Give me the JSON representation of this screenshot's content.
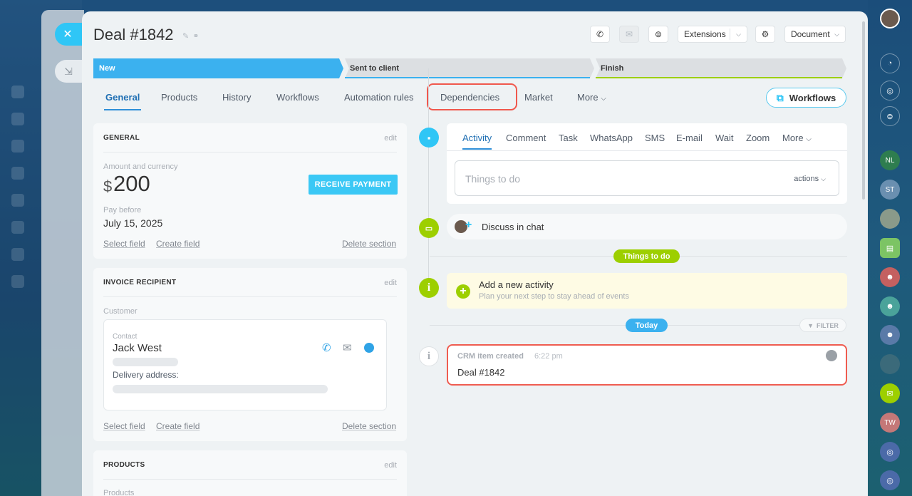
{
  "deal": {
    "title": "Deal #1842"
  },
  "toolbar": {
    "extensions_label": "Extensions",
    "document_label": "Document"
  },
  "stages": [
    {
      "label": "New",
      "color": "#3bb1ef"
    },
    {
      "label": "Sent to client",
      "color": "#dcdfe2"
    },
    {
      "label": "Finish",
      "color": "#dcdfe2"
    }
  ],
  "tabs": {
    "general": "General",
    "products": "Products",
    "history": "History",
    "workflows": "Workflows",
    "automation": "Automation rules",
    "dependencies": "Dependencies",
    "market": "Market",
    "more": "More"
  },
  "workflows_button": "Workflows",
  "general_section": {
    "header": "GENERAL",
    "edit": "edit",
    "amount_label": "Amount and currency",
    "currency_symbol": "$",
    "amount": "200",
    "pay_button": "RECEIVE PAYMENT",
    "pay_before_label": "Pay before",
    "pay_before": "July 15, 2025",
    "select_field": "Select field",
    "create_field": "Create field",
    "delete_section": "Delete section"
  },
  "recipient_section": {
    "header": "INVOICE RECIPIENT",
    "edit": "edit",
    "customer_label": "Customer",
    "contact_label": "Contact",
    "contact_name": "Jack West",
    "delivery_label": "Delivery address:",
    "select_field": "Select field",
    "create_field": "Create field",
    "delete_section": "Delete section"
  },
  "products_section": {
    "header": "PRODUCTS",
    "edit": "edit",
    "products_label": "Products"
  },
  "activity_editor": {
    "tabs": [
      "Activity",
      "Comment",
      "Task",
      "WhatsApp",
      "SMS",
      "E-mail",
      "Wait",
      "Zoom",
      "More"
    ],
    "placeholder": "Things to do",
    "actions": "actions"
  },
  "timeline": {
    "discuss": "Discuss in chat",
    "todo_pill": "Things to do",
    "new_activity_title": "Add a new activity",
    "new_activity_sub": "Plan your next step to stay ahead of events",
    "today_pill": "Today",
    "filter": "FILTER",
    "crm_title": "CRM item created",
    "crm_time": "6:22 pm",
    "crm_body": "Deal #1842"
  },
  "rightbar": {
    "initials_nl": "NL",
    "initials_st": "ST",
    "initials_tw": "TW"
  },
  "colors": {
    "accent": "#2f8fd8",
    "highlight": "#f0584d",
    "green": "#9dcf00",
    "blue_pill": "#3bb1ef"
  }
}
